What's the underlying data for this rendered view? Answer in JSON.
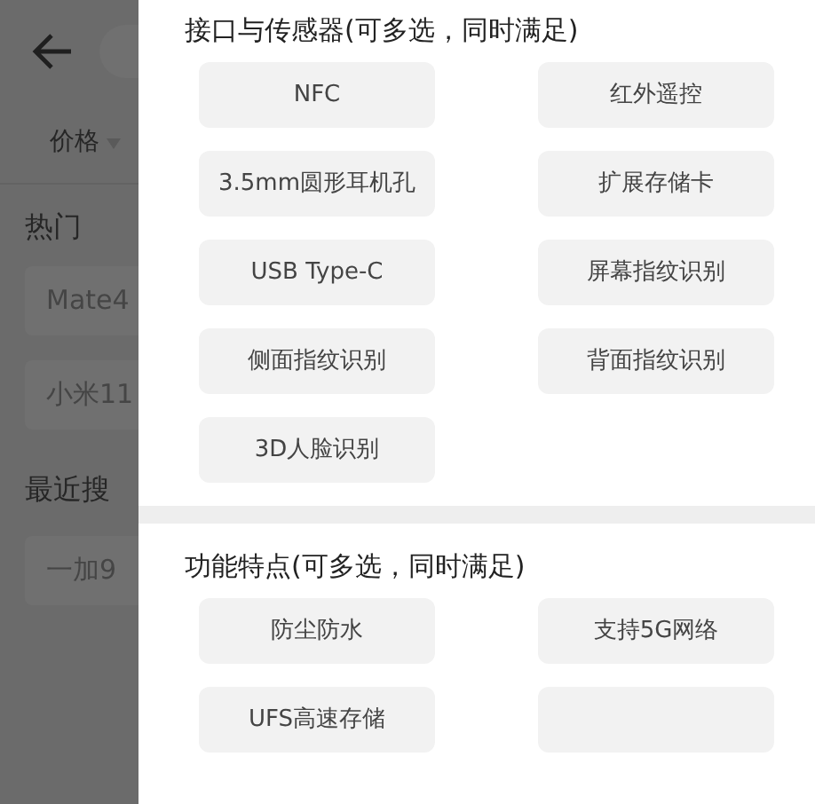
{
  "background_page": {
    "price_filter": "价格",
    "hot_title": "热门",
    "hot_chips": [
      "Mate4",
      "小米11"
    ],
    "recent_title": "最近搜",
    "recent_chips": [
      "一加9"
    ]
  },
  "sections": [
    {
      "title": "接口与传感器(可多选，同时满足)",
      "options": [
        {
          "kind": "text",
          "label": "NFC"
        },
        {
          "kind": "text",
          "label": "红外遥控"
        },
        {
          "kind": "text",
          "label": "3.5mm圆形耳机孔"
        },
        {
          "kind": "text",
          "label": "扩展存储卡"
        },
        {
          "kind": "text",
          "label": "USB Type-C"
        },
        {
          "kind": "text",
          "label": "屏幕指纹识别"
        },
        {
          "kind": "text",
          "label": "侧面指纹识别"
        },
        {
          "kind": "text",
          "label": "背面指纹识别"
        },
        {
          "kind": "text",
          "label": "3D人脸识别"
        }
      ]
    },
    {
      "title": "功能特点(可多选，同时满足)",
      "options": [
        {
          "kind": "text",
          "label": "防尘防水"
        },
        {
          "kind": "text",
          "label": "支持5G网络"
        },
        {
          "kind": "text",
          "label": "UFS高速存储"
        },
        {
          "kind": "covered"
        }
      ]
    }
  ]
}
